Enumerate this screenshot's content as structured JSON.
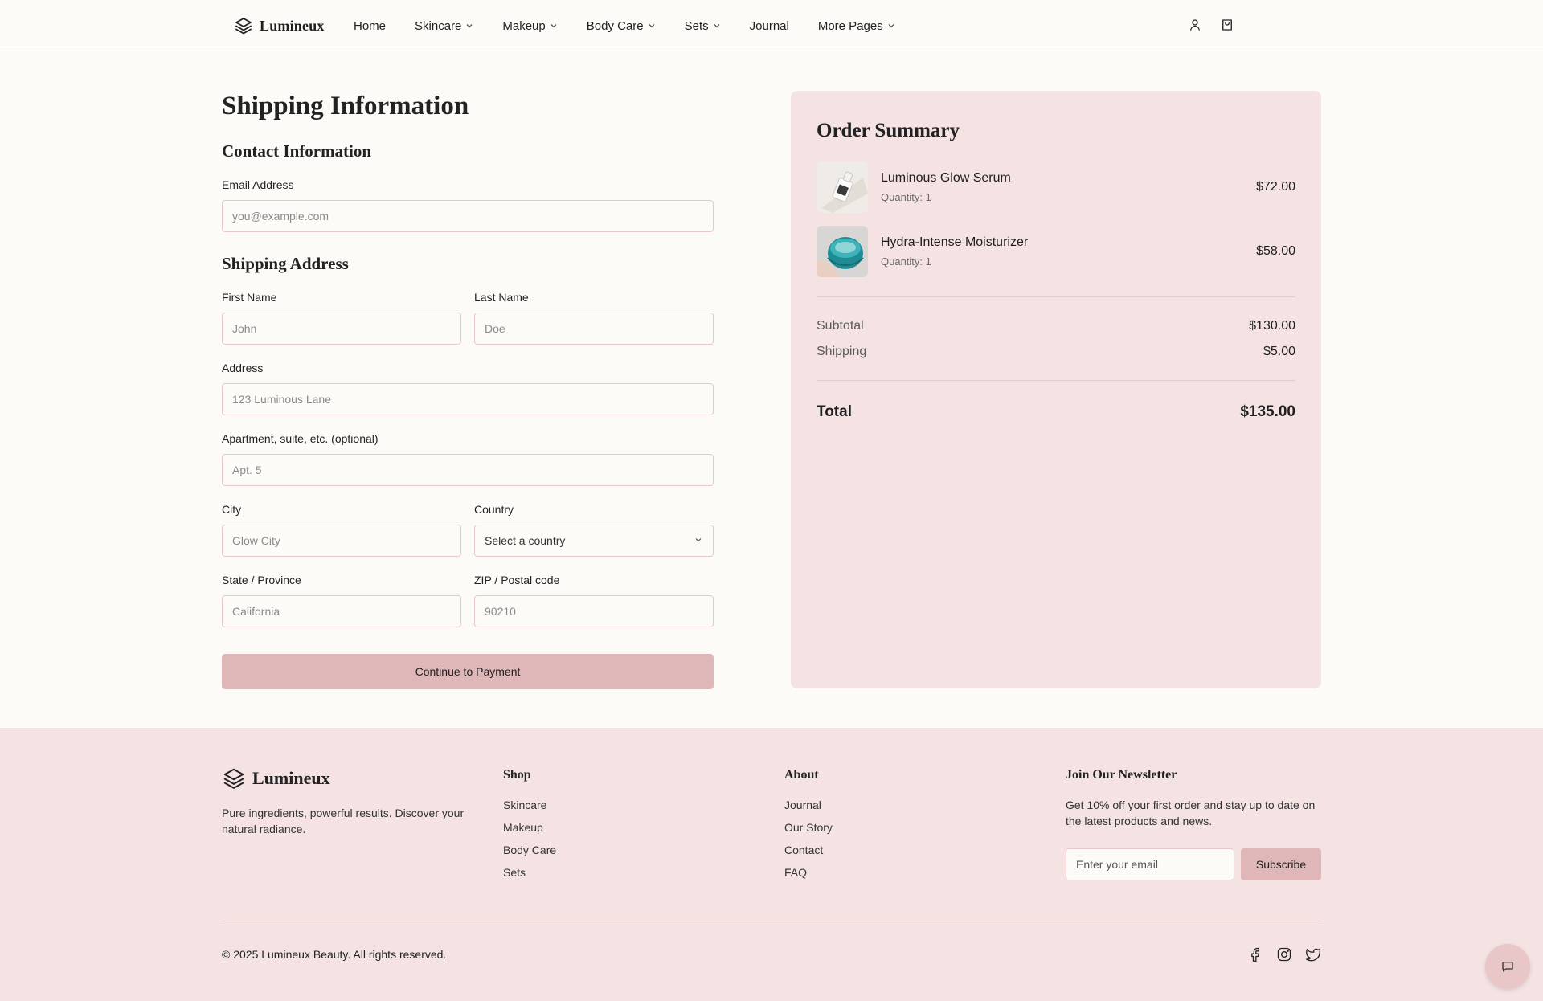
{
  "brand": {
    "name": "Lumineux"
  },
  "nav": {
    "links": [
      {
        "label": "Home",
        "dropdown": false
      },
      {
        "label": "Skincare",
        "dropdown": true
      },
      {
        "label": "Makeup",
        "dropdown": true
      },
      {
        "label": "Body Care",
        "dropdown": true
      },
      {
        "label": "Sets",
        "dropdown": true
      },
      {
        "label": "Journal",
        "dropdown": false
      },
      {
        "label": "More Pages",
        "dropdown": true
      }
    ],
    "icons": [
      "user-icon",
      "shopping-bag-icon"
    ]
  },
  "shipping": {
    "title": "Shipping Information",
    "contact_title": "Contact Information",
    "email_label": "Email Address",
    "email_placeholder": "you@example.com",
    "address_title": "Shipping Address",
    "first_name_label": "First Name",
    "first_name_placeholder": "John",
    "last_name_label": "Last Name",
    "last_name_placeholder": "Doe",
    "address_label": "Address",
    "address_placeholder": "123 Luminous Lane",
    "apartment_label": "Apartment, suite, etc. (optional)",
    "apartment_placeholder": "Apt. 5",
    "city_label": "City",
    "city_placeholder": "Glow City",
    "country_label": "Country",
    "country_selected": "Select a country",
    "state_label": "State / Province",
    "state_placeholder": "California",
    "zip_label": "ZIP / Postal code",
    "zip_placeholder": "90210",
    "continue_label": "Continue to Payment"
  },
  "summary": {
    "title": "Order Summary",
    "items": [
      {
        "name": "Luminous Glow Serum",
        "quantity": "Quantity: 1",
        "price": "$72.00",
        "image": "serum-bottle-thumbnail"
      },
      {
        "name": "Hydra-Intense Moisturizer",
        "quantity": "Quantity: 1",
        "price": "$58.00",
        "image": "moisturizer-jar-thumbnail"
      }
    ],
    "subtotal_label": "Subtotal",
    "subtotal_value": "$130.00",
    "shipping_label": "Shipping",
    "shipping_value": "$5.00",
    "total_label": "Total",
    "total_value": "$135.00"
  },
  "footer": {
    "brand": "Lumineux",
    "tagline": "Pure ingredients, powerful results. Discover your natural radiance.",
    "shop_title": "Shop",
    "shop_links": [
      "Skincare",
      "Makeup",
      "Body Care",
      "Sets"
    ],
    "about_title": "About",
    "about_links": [
      "Journal",
      "Our Story",
      "Contact",
      "FAQ"
    ],
    "newsletter_title": "Join Our Newsletter",
    "newsletter_text": "Get 10% off your first order and stay up to date on the latest products and news.",
    "newsletter_placeholder": "Enter your email",
    "subscribe_label": "Subscribe",
    "copyright": "© 2025 Lumineux Beauty. All rights reserved.",
    "socials": [
      "facebook-icon",
      "instagram-icon",
      "twitter-icon"
    ]
  },
  "colors": {
    "background": "#fdfbf7",
    "accent_pink": "#e0b7b9",
    "panel_pink": "#f5e3e4",
    "input_border": "#e8c9cc"
  }
}
